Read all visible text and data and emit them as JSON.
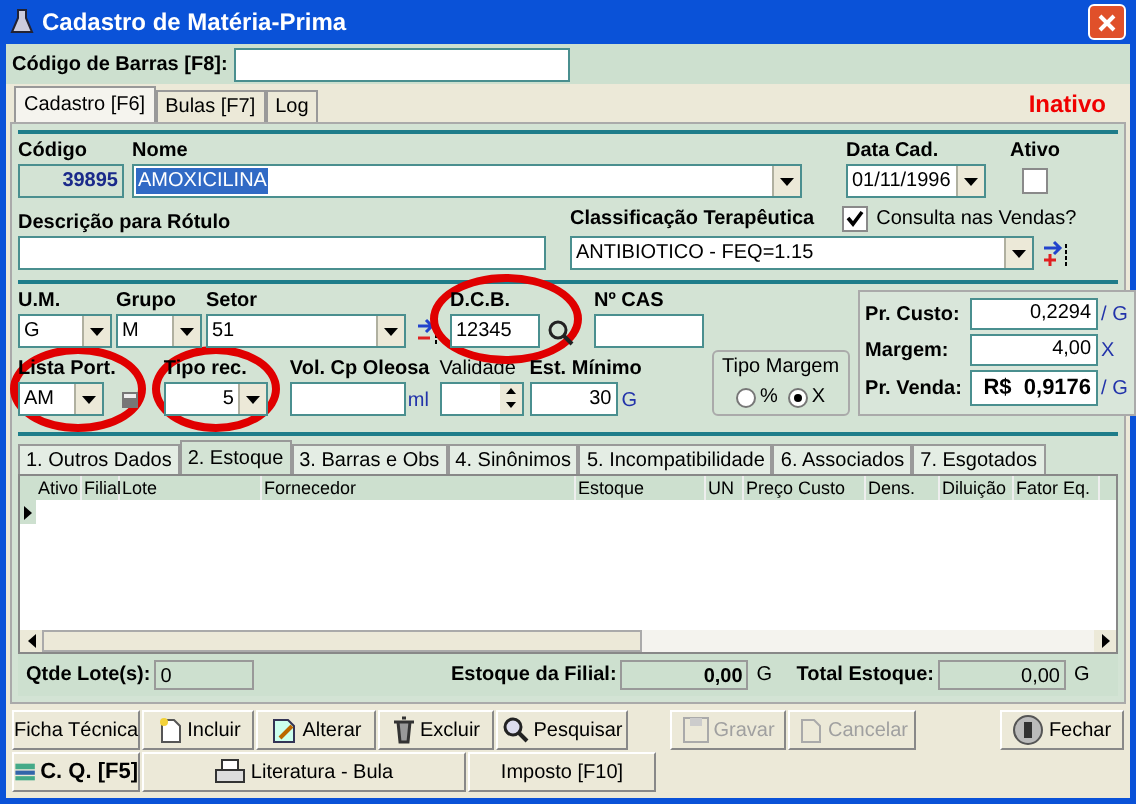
{
  "window": {
    "title": "Cadastro de Matéria-Prima"
  },
  "barcode": {
    "label": "Código de Barras [F8]:"
  },
  "tabs": [
    {
      "label": "Cadastro [F6]",
      "selected": true
    },
    {
      "label": "Bulas [F7]",
      "selected": false
    },
    {
      "label": "Log",
      "selected": false
    }
  ],
  "status": "Inativo",
  "codigo": {
    "label": "Código",
    "value": "39895"
  },
  "nome": {
    "label": "Nome",
    "value": "AMOXICILINA"
  },
  "data_cad": {
    "label": "Data Cad.",
    "value": "01/11/1996"
  },
  "ativo": {
    "label": "Ativo",
    "checked": false
  },
  "descricao": {
    "label": "Descrição para Rótulo"
  },
  "classificacao": {
    "label": "Classificação Terapêutica",
    "value": "ANTIBIOTICO - FEQ=1.15"
  },
  "consulta_vendas": {
    "label": "Consulta nas Vendas?",
    "checked": true
  },
  "um": {
    "label": "U.M.",
    "value": "G"
  },
  "grupo": {
    "label": "Grupo",
    "value": "M"
  },
  "setor": {
    "label": "Setor",
    "value": "51"
  },
  "dcb": {
    "label": "D.C.B.",
    "value": "12345"
  },
  "cas": {
    "label": "Nº CAS"
  },
  "lista_port": {
    "label": "Lista Port.",
    "value": "AM"
  },
  "tipo_rec": {
    "label": "Tipo rec.",
    "value": "5"
  },
  "vol_cp_oleosa": {
    "label": "Vol. Cp Oleosa",
    "unit": "ml"
  },
  "validade": {
    "label": "Validade"
  },
  "est_minimo": {
    "label": "Est. Mínimo",
    "value": "30",
    "unit": "G"
  },
  "tipo_margem": {
    "label": "Tipo Margem",
    "options": [
      {
        "label": "%",
        "selected": false
      },
      {
        "label": "X",
        "selected": true
      }
    ]
  },
  "prices": [
    {
      "label": "Pr. Custo:",
      "value": "0,2294",
      "unit": "/ G",
      "kind": "normal"
    },
    {
      "label": "Margem:",
      "value": "4,00",
      "unit": "X",
      "kind": "normal"
    },
    {
      "label": "Pr. Venda:",
      "value": "R$  0,9176",
      "unit": "/ G",
      "kind": "big"
    }
  ],
  "subtabs": [
    {
      "label": "1. Outros Dados",
      "selected": false
    },
    {
      "label": "2. Estoque",
      "selected": true
    },
    {
      "label": "3. Barras e Obs",
      "selected": false
    },
    {
      "label": "4. Sinônimos",
      "selected": false
    },
    {
      "label": "5. Incompatibilidade",
      "selected": false
    },
    {
      "label": "6. Associados",
      "selected": false
    },
    {
      "label": "7. Esgotados",
      "selected": false
    }
  ],
  "grid": {
    "columns": [
      "Ativo",
      "Filial",
      "Lote",
      "Fornecedor",
      "Estoque",
      "UN",
      "Preço Custo",
      "Dens.",
      "Diluição",
      "Fator Eq."
    ]
  },
  "totals": {
    "qtde": {
      "label": "Qtde Lote(s):",
      "value": "0"
    },
    "filial": {
      "label": "Estoque da Filial:",
      "value": "0,00",
      "unit": "G"
    },
    "total": {
      "label": "Total Estoque:",
      "value": "0,00",
      "unit": "G"
    }
  },
  "buttons_row1": [
    {
      "label": "Ficha Técnica",
      "kind": "text",
      "disabled": false
    },
    {
      "label": "Incluir",
      "kind": "new",
      "disabled": false
    },
    {
      "label": "Alterar",
      "kind": "edit",
      "disabled": false
    },
    {
      "label": "Excluir",
      "kind": "trash",
      "disabled": false
    },
    {
      "label": "Pesquisar",
      "kind": "search",
      "disabled": false
    },
    {
      "label": "Gravar",
      "kind": "save",
      "disabled": true
    },
    {
      "label": "Cancelar",
      "kind": "cancel",
      "disabled": true
    },
    {
      "label": "Fechar",
      "kind": "exit",
      "disabled": false
    }
  ],
  "buttons_row2": [
    {
      "label": "C. Q. [F5]",
      "kind": "cq",
      "disabled": false
    },
    {
      "label": "Literatura - Bula",
      "kind": "print",
      "disabled": false
    },
    {
      "label": "Imposto [F10]",
      "kind": "text",
      "disabled": false
    }
  ]
}
